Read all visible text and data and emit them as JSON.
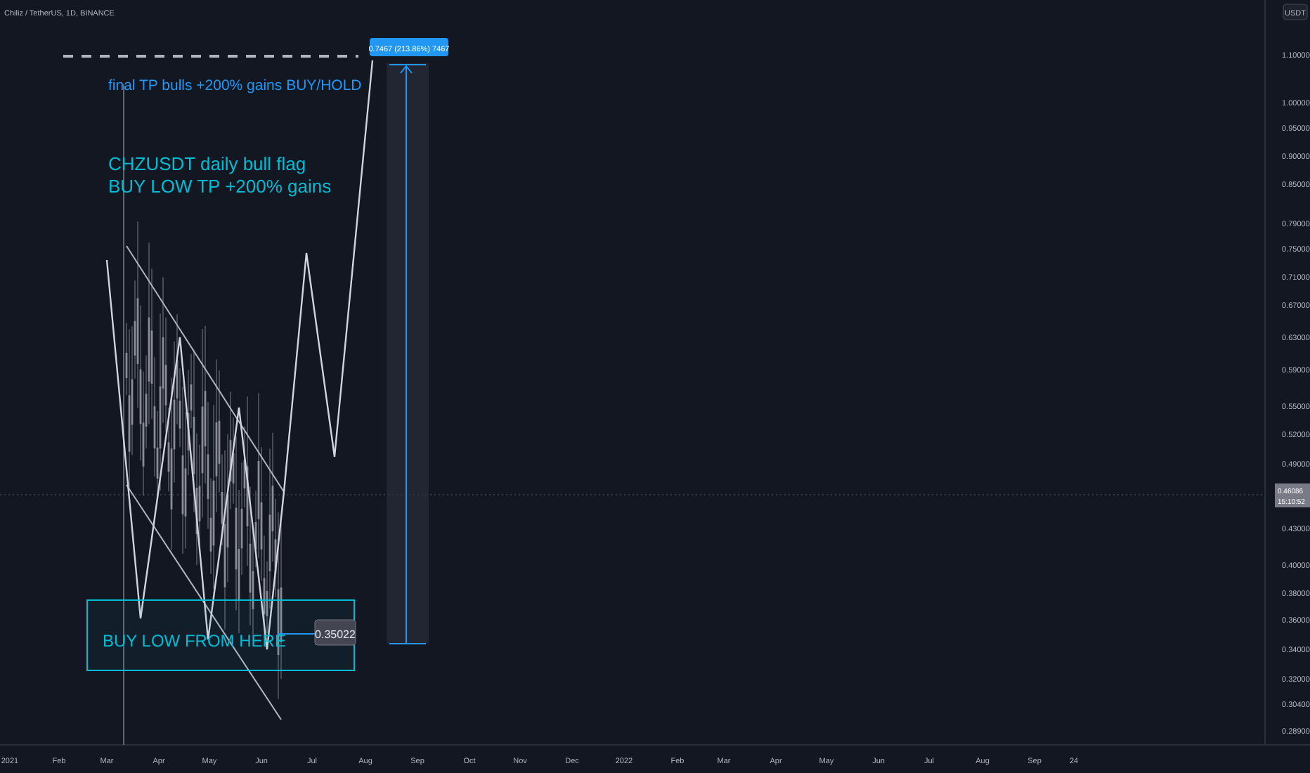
{
  "header": {
    "symbol_line": "Chiliz / TetherUS, 1D, BINANCE"
  },
  "target_note": "final TP bulls +200% gains BUY/HOLD",
  "title_lines": [
    "CHZUSDT daily bull flag",
    "BUY LOW TP +200% gains"
  ],
  "buy_zone": {
    "label": "BUY LOW FROM HERE",
    "price_tag": "0.35022"
  },
  "measure": {
    "label": "0.7467 (213.86%) 7467"
  },
  "price_axis": {
    "unit": "USDT",
    "labels": [
      "1.10000",
      "1.00000",
      "0.95000",
      "0.90000",
      "0.85000",
      "0.79000",
      "0.75000",
      "0.71000",
      "0.67000",
      "0.63000",
      "0.59000",
      "0.55000",
      "0.52000",
      "0.49000",
      "0.43000",
      "0.40000",
      "0.38000",
      "0.36000",
      "0.34000",
      "0.32000",
      "0.30400",
      "0.28900"
    ],
    "current": {
      "price": "0.46086",
      "countdown": "15:10:52"
    }
  },
  "time_axis": [
    "2021",
    "Feb",
    "Mar",
    "Apr",
    "May",
    "Jun",
    "Jul",
    "Aug",
    "Sep",
    "Oct",
    "Nov",
    "Dec",
    "2022",
    "Feb",
    "Mar",
    "Apr",
    "May",
    "Jun",
    "Jul",
    "Aug",
    "Sep",
    "24"
  ]
}
